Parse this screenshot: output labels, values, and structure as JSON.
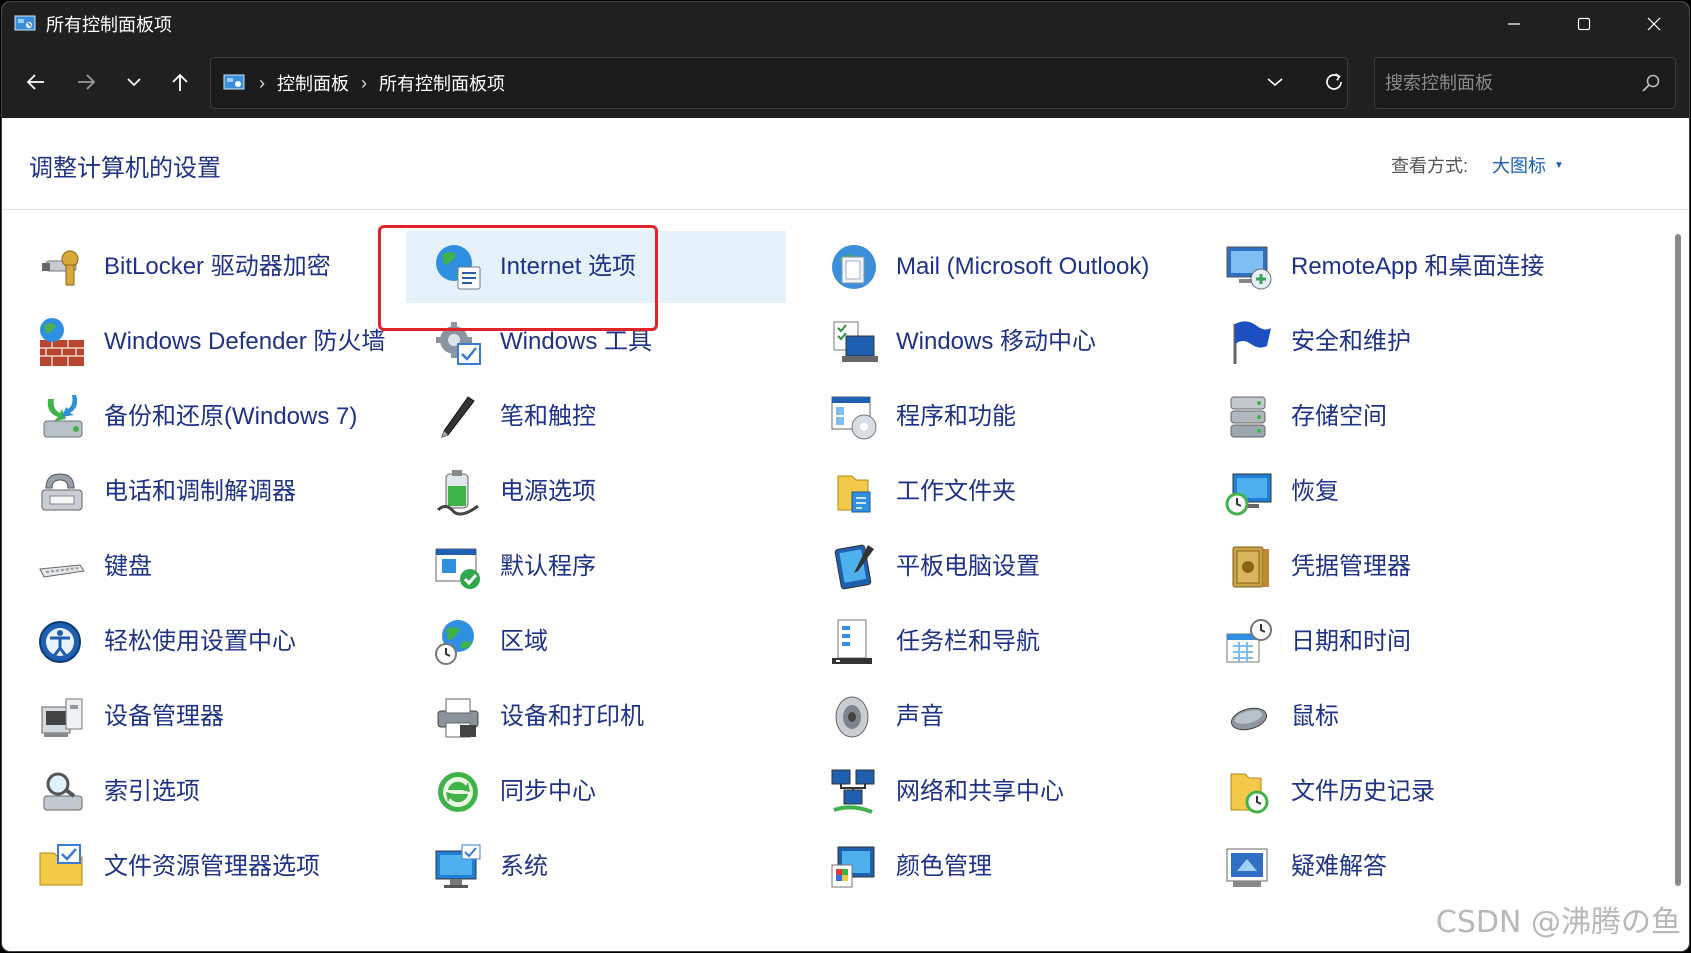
{
  "window": {
    "title": "所有控制面板项",
    "minimize_icon": "minimize-icon",
    "maximize_icon": "maximize-icon",
    "close_icon": "close-icon"
  },
  "nav": {
    "breadcrumb": [
      "控制面板",
      "所有控制面板项"
    ],
    "search_placeholder": "搜索控制面板"
  },
  "header": {
    "title": "调整计算机的设置",
    "view_by_label": "查看方式:",
    "view_by_value": "大图标"
  },
  "items": [
    {
      "label": "BitLocker 驱动器加密",
      "icon": "bitlocker-icon"
    },
    {
      "label": "Internet 选项",
      "icon": "internet-options-icon"
    },
    {
      "label": "Mail (Microsoft Outlook)",
      "icon": "mail-icon"
    },
    {
      "label": "RemoteApp 和桌面连接",
      "icon": "remoteapp-icon"
    },
    {
      "label": "Windows Defender 防火墙",
      "icon": "firewall-icon"
    },
    {
      "label": "Windows 工具",
      "icon": "windows-tools-icon"
    },
    {
      "label": "Windows 移动中心",
      "icon": "mobility-center-icon"
    },
    {
      "label": "安全和维护",
      "icon": "security-flag-icon"
    },
    {
      "label": "备份和还原(Windows 7)",
      "icon": "backup-icon"
    },
    {
      "label": "笔和触控",
      "icon": "pen-icon"
    },
    {
      "label": "程序和功能",
      "icon": "programs-icon"
    },
    {
      "label": "存储空间",
      "icon": "storage-icon"
    },
    {
      "label": "电话和调制解调器",
      "icon": "phone-modem-icon"
    },
    {
      "label": "电源选项",
      "icon": "power-icon"
    },
    {
      "label": "工作文件夹",
      "icon": "work-folders-icon"
    },
    {
      "label": "恢复",
      "icon": "recovery-icon"
    },
    {
      "label": "键盘",
      "icon": "keyboard-icon"
    },
    {
      "label": "默认程序",
      "icon": "default-programs-icon"
    },
    {
      "label": "平板电脑设置",
      "icon": "tablet-icon"
    },
    {
      "label": "凭据管理器",
      "icon": "credential-icon"
    },
    {
      "label": "轻松使用设置中心",
      "icon": "ease-of-access-icon"
    },
    {
      "label": "区域",
      "icon": "region-icon"
    },
    {
      "label": "任务栏和导航",
      "icon": "taskbar-icon"
    },
    {
      "label": "日期和时间",
      "icon": "date-time-icon"
    },
    {
      "label": "设备管理器",
      "icon": "device-manager-icon"
    },
    {
      "label": "设备和打印机",
      "icon": "printer-icon"
    },
    {
      "label": "声音",
      "icon": "sound-icon"
    },
    {
      "label": "鼠标",
      "icon": "mouse-icon"
    },
    {
      "label": "索引选项",
      "icon": "indexing-icon"
    },
    {
      "label": "同步中心",
      "icon": "sync-icon"
    },
    {
      "label": "网络和共享中心",
      "icon": "network-icon"
    },
    {
      "label": "文件历史记录",
      "icon": "file-history-icon"
    },
    {
      "label": "文件资源管理器选项",
      "icon": "folder-options-icon"
    },
    {
      "label": "系统",
      "icon": "system-icon"
    },
    {
      "label": "颜色管理",
      "icon": "color-management-icon"
    },
    {
      "label": "疑难解答",
      "icon": "troubleshoot-icon"
    }
  ],
  "highlighted_item": "Internet 选项",
  "watermark": "CSDN @沸腾の鱼"
}
